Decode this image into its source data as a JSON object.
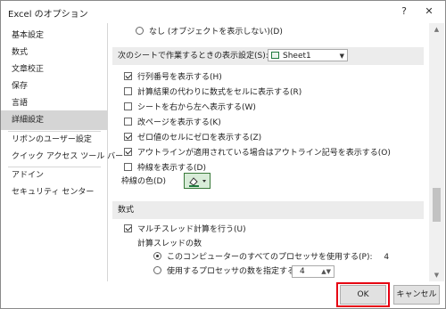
{
  "window": {
    "title": "Excel のオプション",
    "help_glyph": "?",
    "close_glyph": "✕"
  },
  "sidebar": {
    "items": [
      {
        "label": "基本設定"
      },
      {
        "label": "数式"
      },
      {
        "label": "文章校正"
      },
      {
        "label": "保存"
      },
      {
        "label": "言語"
      },
      {
        "label": "詳細設定",
        "selected": true
      },
      {
        "label": "リボンのユーザー設定"
      },
      {
        "label": "クイック アクセス ツール バー"
      },
      {
        "label": "アドイン"
      },
      {
        "label": "セキュリティ センター"
      }
    ]
  },
  "content": {
    "top_radio_label": "なし (オブジェクトを表示しない)(D)",
    "sheet_section": {
      "label": "次のシートで作業するときの表示設定(S):",
      "sheet_value": "Sheet1"
    },
    "options": [
      {
        "label": "行列番号を表示する(H)",
        "checked": true
      },
      {
        "label": "計算結果の代わりに数式をセルに表示する(R)",
        "checked": false
      },
      {
        "label": "シートを右から左へ表示する(W)",
        "checked": false
      },
      {
        "label": "改ページを表示する(K)",
        "checked": false
      },
      {
        "label": "ゼロ値のセルにゼロを表示する(Z)",
        "checked": true
      },
      {
        "label": "アウトラインが適用されている場合はアウトライン記号を表示する(O)",
        "checked": true
      },
      {
        "label": "枠線を表示する(D)",
        "checked": false
      }
    ],
    "gridline_color_label": "枠線の色(D)",
    "formula_section": {
      "title": "数式",
      "multithread_label": "マルチスレッド計算を行う(U)",
      "multithread_checked": true,
      "threads_label": "計算スレッドの数",
      "all_processors_label": "このコンピューターのすべてのプロセッサを使用する(P):",
      "all_processors_value": "4",
      "manual_label": "使用するプロセッサの数を指定する(M):",
      "manual_value": "4"
    }
  },
  "buttons": {
    "ok": "OK",
    "cancel": "キャンセル"
  },
  "colors": {
    "highlight": "#e60012",
    "selected_bg": "#d5d5d5",
    "section_bg": "#ececec"
  }
}
